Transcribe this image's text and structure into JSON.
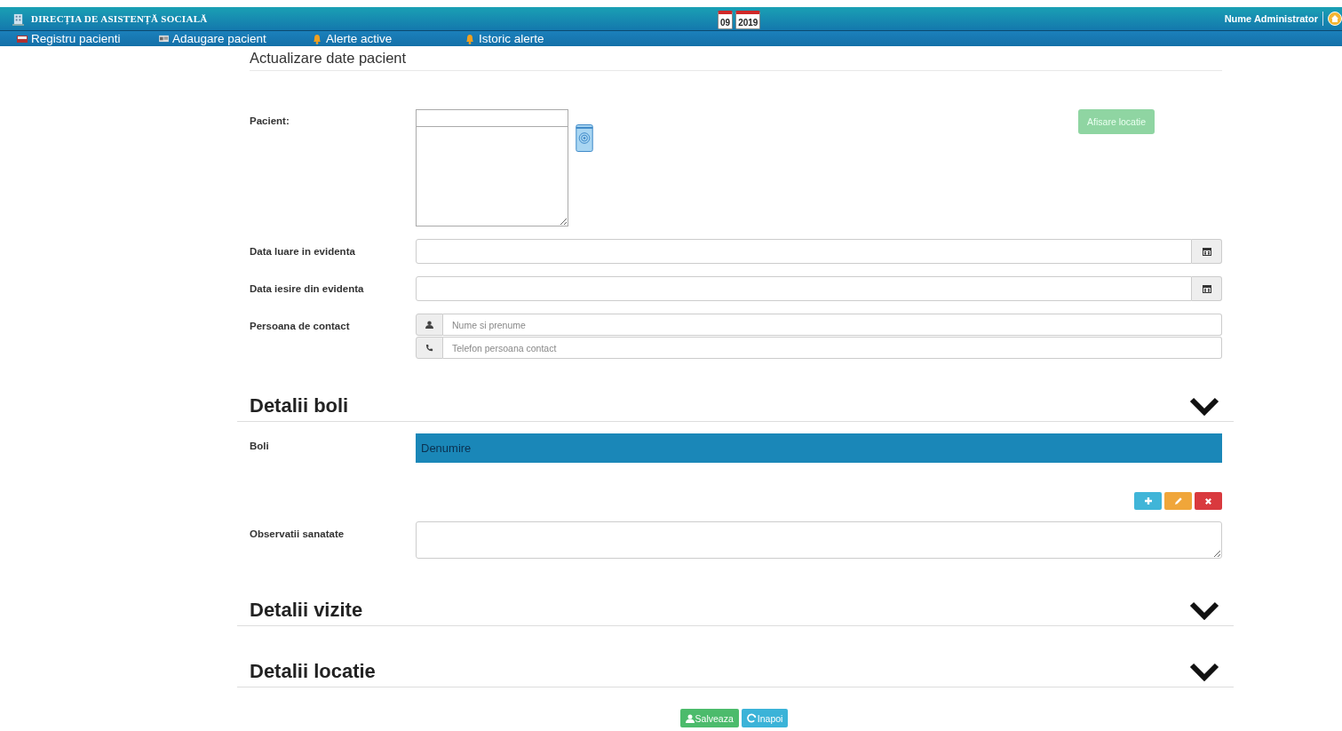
{
  "header": {
    "title": "DIRECȚIA DE ASISTENȚĂ SOCIALĂ",
    "date_day": "09",
    "date_year": "2019",
    "user": "Nume Administrator"
  },
  "nav": [
    {
      "label": "Registru pacienti",
      "kind": "book"
    },
    {
      "label": "Adaugare pacient",
      "kind": "card"
    },
    {
      "label": "Alerte active",
      "kind": "bell"
    },
    {
      "label": "Istoric alerte",
      "kind": "bell"
    }
  ],
  "page_title": "Actualizare date pacient",
  "patient": {
    "label": "Pacient:",
    "location_button": {
      "label": "Afisare locatie",
      "disabled": true
    }
  },
  "dates": [
    {
      "label": "Data luare in evidenta"
    },
    {
      "label": "Data iesire din evidenta"
    }
  ],
  "contact": {
    "label": "Persoana de contact",
    "fields": [
      {
        "kind": "person",
        "placeholder": "Nume si prenume"
      },
      {
        "kind": "phone",
        "placeholder": "Telefon persoana contact"
      }
    ]
  },
  "sections": [
    {
      "title": "Detalii boli",
      "kind": "diseases"
    },
    {
      "title": "Detalii vizite",
      "kind": "plain"
    },
    {
      "title": "Detalii locatie",
      "kind": "plain"
    }
  ],
  "diseases": {
    "label": "Boli",
    "columns": [
      "Denumire"
    ],
    "notes_label": "Observatii sanatate"
  },
  "actions": [
    {
      "label": "Salveaza",
      "kind": "save"
    },
    {
      "label": "Inapoi",
      "kind": "back"
    }
  ]
}
